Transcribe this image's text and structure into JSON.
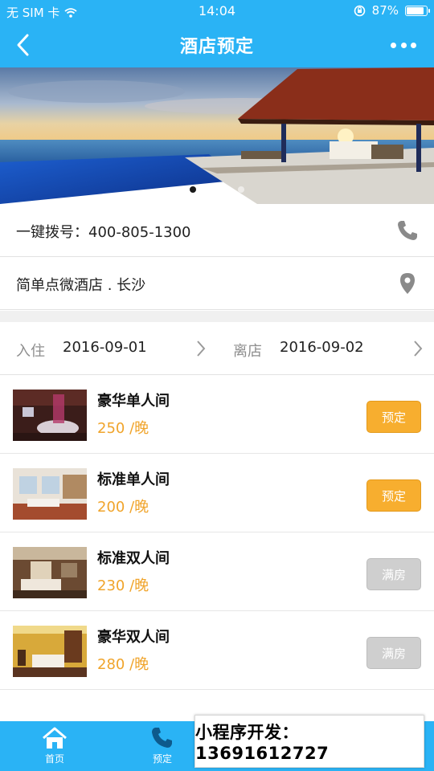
{
  "status_bar": {
    "carrier": "无 SIM 卡",
    "time": "14:04",
    "battery": "87%",
    "battery_level": 0.87
  },
  "nav": {
    "title": "酒店预定"
  },
  "banner": {
    "slide_count": 3,
    "active_slide": 0
  },
  "contact": {
    "phone_text": "一键拨号：400-805-1300"
  },
  "location": {
    "hotel_text": "简单点微酒店 . 长沙"
  },
  "dates": {
    "checkin_label": "入住",
    "checkin_value": "2016-09-01",
    "checkout_label": "离店",
    "checkout_value": "2016-09-02"
  },
  "rooms": [
    {
      "name": "豪华单人间",
      "price": "250 /晚",
      "button": "预定",
      "available": true
    },
    {
      "name": "标准单人间",
      "price": "200 /晚",
      "button": "预定",
      "available": true
    },
    {
      "name": "标准双人间",
      "price": "230 /晚",
      "button": "满房",
      "available": false
    },
    {
      "name": "豪华双人间",
      "price": "280 /晚",
      "button": "满房",
      "available": false
    }
  ],
  "tabs": [
    {
      "label": "首页",
      "icon": "home-icon"
    },
    {
      "label": "预定",
      "icon": "phone-icon"
    }
  ],
  "promo": {
    "text": "小程序开发：13691612727"
  },
  "colors": {
    "primary": "#2ab3f5",
    "book": "#f7ae2f",
    "full": "#cfcfcf",
    "price": "#f0a42b"
  }
}
